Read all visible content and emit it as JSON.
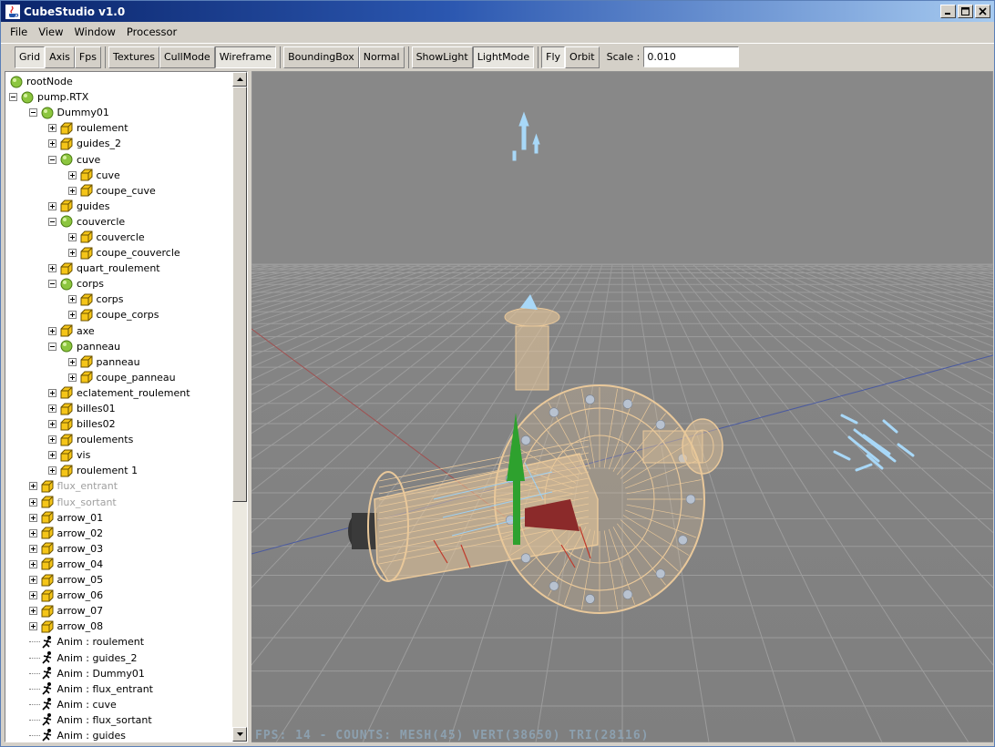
{
  "window": {
    "title": "CubeStudio v1.0"
  },
  "menu": [
    "File",
    "View",
    "Window",
    "Processor"
  ],
  "toolbar": {
    "groups": [
      [
        {
          "label": "Grid",
          "pressed": true
        },
        {
          "label": "Axis",
          "pressed": false
        },
        {
          "label": "Fps",
          "pressed": false
        }
      ],
      [
        {
          "label": "Textures",
          "pressed": false
        },
        {
          "label": "CullMode",
          "pressed": false
        },
        {
          "label": "Wireframe",
          "pressed": true
        }
      ],
      [
        {
          "label": "BoundingBox",
          "pressed": false
        },
        {
          "label": "Normal",
          "pressed": false
        }
      ],
      [
        {
          "label": "ShowLight",
          "pressed": false
        },
        {
          "label": "LightMode",
          "pressed": true
        }
      ],
      [
        {
          "label": "Fly",
          "pressed": true
        },
        {
          "label": "Orbit",
          "pressed": false
        }
      ]
    ],
    "scale_label": "Scale :",
    "scale_value": "0.010"
  },
  "tree": [
    {
      "label": "rootNode",
      "depth": 0,
      "icon": "node",
      "exp": "none"
    },
    {
      "label": "pump.RTX",
      "depth": 0,
      "icon": "node",
      "exp": "minus"
    },
    {
      "label": "Dummy01",
      "depth": 1,
      "icon": "node",
      "exp": "minus"
    },
    {
      "label": "roulement",
      "depth": 2,
      "icon": "mesh",
      "exp": "plus"
    },
    {
      "label": "guides_2",
      "depth": 2,
      "icon": "mesh",
      "exp": "plus"
    },
    {
      "label": "cuve",
      "depth": 2,
      "icon": "node",
      "exp": "minus"
    },
    {
      "label": "cuve",
      "depth": 3,
      "icon": "mesh",
      "exp": "plus"
    },
    {
      "label": "coupe_cuve",
      "depth": 3,
      "icon": "mesh",
      "exp": "plus"
    },
    {
      "label": "guides",
      "depth": 2,
      "icon": "mesh",
      "exp": "plus"
    },
    {
      "label": "couvercle",
      "depth": 2,
      "icon": "node",
      "exp": "minus"
    },
    {
      "label": "couvercle",
      "depth": 3,
      "icon": "mesh",
      "exp": "plus"
    },
    {
      "label": "coupe_couvercle",
      "depth": 3,
      "icon": "mesh",
      "exp": "plus"
    },
    {
      "label": "quart_roulement",
      "depth": 2,
      "icon": "mesh",
      "exp": "plus"
    },
    {
      "label": "corps",
      "depth": 2,
      "icon": "node",
      "exp": "minus"
    },
    {
      "label": "corps",
      "depth": 3,
      "icon": "mesh",
      "exp": "plus"
    },
    {
      "label": "coupe_corps",
      "depth": 3,
      "icon": "mesh",
      "exp": "plus"
    },
    {
      "label": "axe",
      "depth": 2,
      "icon": "mesh",
      "exp": "plus"
    },
    {
      "label": "panneau",
      "depth": 2,
      "icon": "node",
      "exp": "minus"
    },
    {
      "label": "panneau",
      "depth": 3,
      "icon": "mesh",
      "exp": "plus"
    },
    {
      "label": "coupe_panneau",
      "depth": 3,
      "icon": "mesh",
      "exp": "plus"
    },
    {
      "label": "eclatement_roulement",
      "depth": 2,
      "icon": "mesh",
      "exp": "plus"
    },
    {
      "label": "billes01",
      "depth": 2,
      "icon": "mesh",
      "exp": "plus"
    },
    {
      "label": "billes02",
      "depth": 2,
      "icon": "mesh",
      "exp": "plus"
    },
    {
      "label": "roulements",
      "depth": 2,
      "icon": "mesh",
      "exp": "plus"
    },
    {
      "label": "vis",
      "depth": 2,
      "icon": "mesh",
      "exp": "plus"
    },
    {
      "label": "roulement 1",
      "depth": 2,
      "icon": "mesh",
      "exp": "plus"
    },
    {
      "label": "flux_entrant",
      "depth": 1,
      "icon": "mesh",
      "exp": "plus",
      "disabled": true
    },
    {
      "label": "flux_sortant",
      "depth": 1,
      "icon": "mesh",
      "exp": "plus",
      "disabled": true
    },
    {
      "label": "arrow_01",
      "depth": 1,
      "icon": "mesh",
      "exp": "plus"
    },
    {
      "label": "arrow_02",
      "depth": 1,
      "icon": "mesh",
      "exp": "plus"
    },
    {
      "label": "arrow_03",
      "depth": 1,
      "icon": "mesh",
      "exp": "plus"
    },
    {
      "label": "arrow_04",
      "depth": 1,
      "icon": "mesh",
      "exp": "plus"
    },
    {
      "label": "arrow_05",
      "depth": 1,
      "icon": "mesh",
      "exp": "plus"
    },
    {
      "label": "arrow_06",
      "depth": 1,
      "icon": "mesh",
      "exp": "plus"
    },
    {
      "label": "arrow_07",
      "depth": 1,
      "icon": "mesh",
      "exp": "plus"
    },
    {
      "label": "arrow_08",
      "depth": 1,
      "icon": "mesh",
      "exp": "plus"
    },
    {
      "label": "Anim : roulement",
      "depth": 1,
      "icon": "anim",
      "exp": "leaf"
    },
    {
      "label": "Anim : guides_2",
      "depth": 1,
      "icon": "anim",
      "exp": "leaf"
    },
    {
      "label": "Anim : Dummy01",
      "depth": 1,
      "icon": "anim",
      "exp": "leaf"
    },
    {
      "label": "Anim : flux_entrant",
      "depth": 1,
      "icon": "anim",
      "exp": "leaf"
    },
    {
      "label": "Anim : cuve",
      "depth": 1,
      "icon": "anim",
      "exp": "leaf"
    },
    {
      "label": "Anim : flux_sortant",
      "depth": 1,
      "icon": "anim",
      "exp": "leaf"
    },
    {
      "label": "Anim : guides",
      "depth": 1,
      "icon": "anim",
      "exp": "leaf"
    }
  ],
  "viewport": {
    "status": "FPS: 14 - COUNTS: MESH(45) VERT(38650) TRI(28116)",
    "background": "#878787",
    "model_color": "#e9c89a"
  }
}
